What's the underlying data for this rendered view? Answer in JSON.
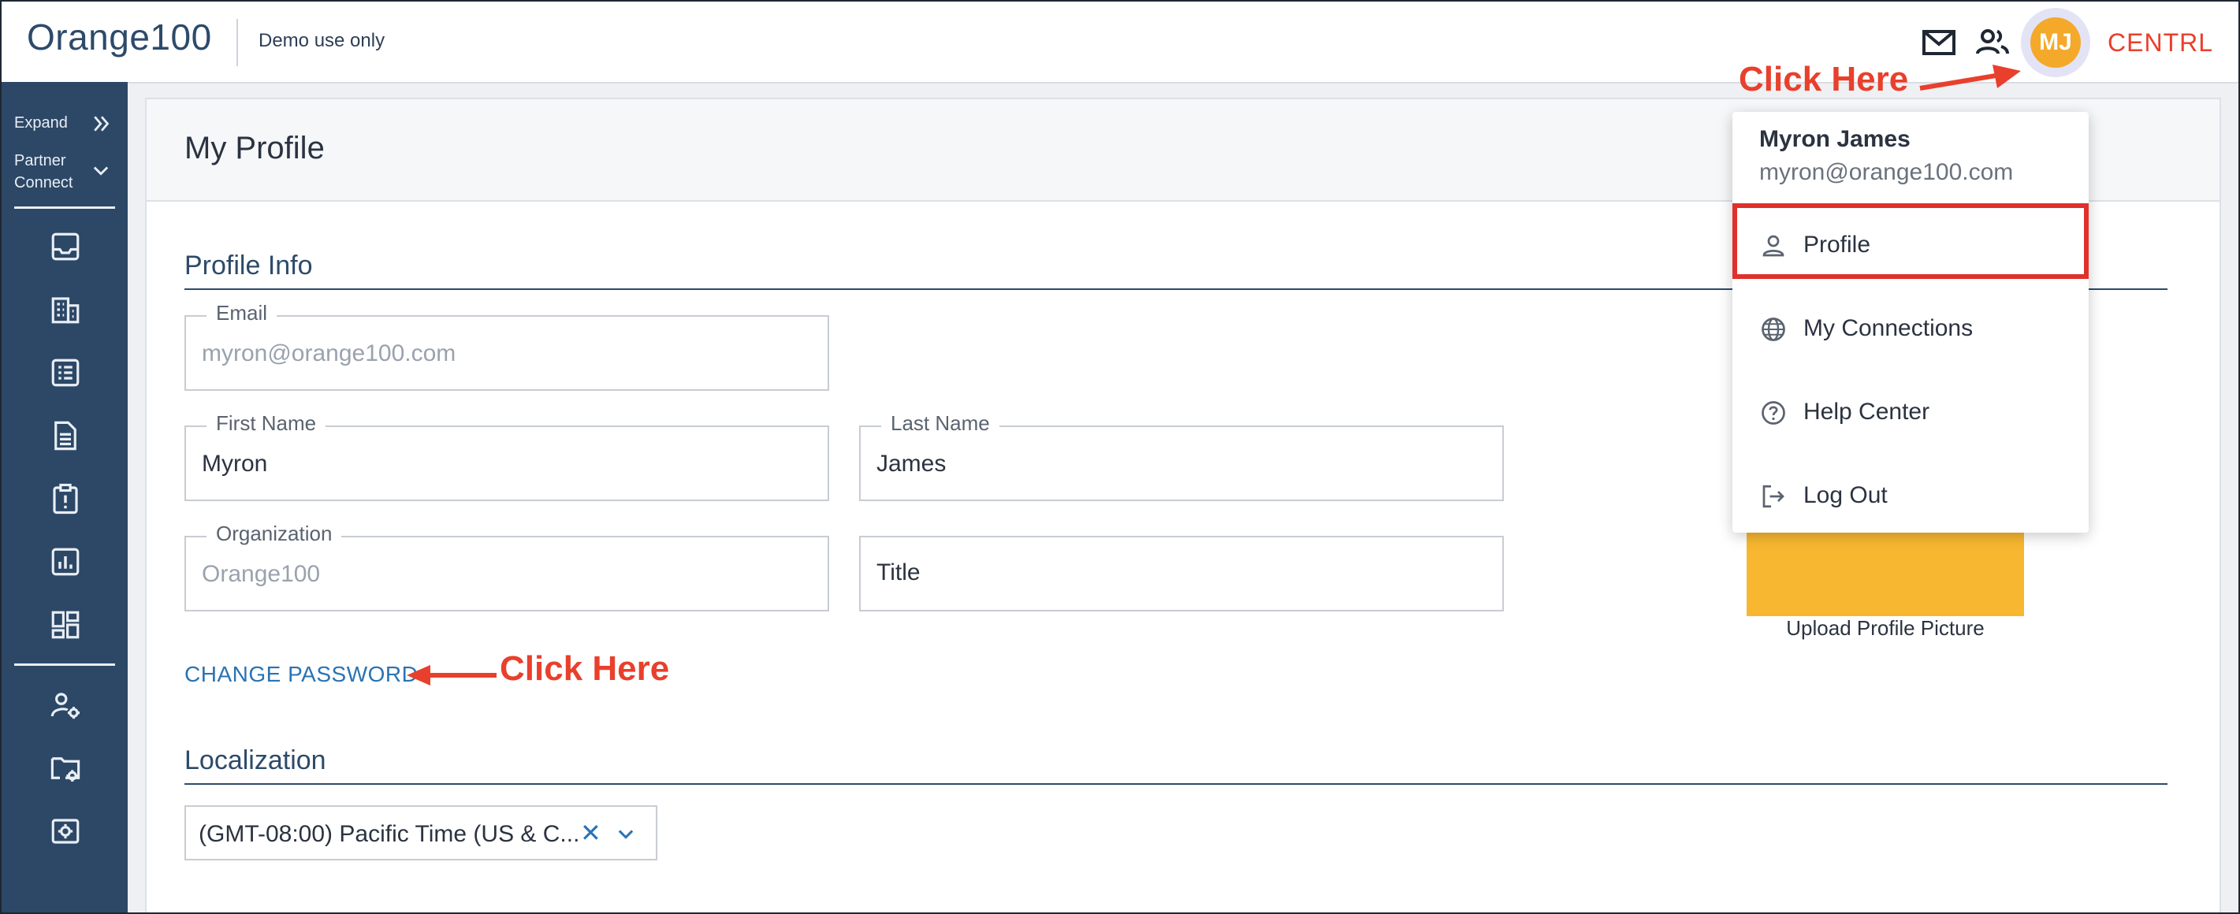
{
  "header": {
    "brand": "Orange100",
    "demo_label": "Demo use only",
    "avatar_initials": "MJ",
    "product": "CENTRL"
  },
  "sidebar": {
    "expand_label": "Expand",
    "partner_line1": "Partner",
    "partner_line2": "Connect",
    "icons": [
      "inbox-icon",
      "building-icon",
      "checklist-icon",
      "document-icon",
      "alert-clipboard-icon",
      "report-chart-icon",
      "dashboard-icon",
      "user-settings-icon",
      "folder-settings-icon",
      "admin-settings-icon"
    ]
  },
  "page": {
    "title": "My Profile"
  },
  "profile_info": {
    "section_title": "Profile Info",
    "email_label": "Email",
    "email_value": "myron@orange100.com",
    "first_name_label": "First Name",
    "first_name_value": "Myron",
    "last_name_label": "Last Name",
    "last_name_value": "James",
    "organization_label": "Organization",
    "organization_value": "Orange100",
    "title_placeholder": "Title",
    "change_password": "CHANGE PASSWORD",
    "upload_label": "Upload Profile Picture"
  },
  "localization": {
    "section_title": "Localization",
    "timezone_value": "(GMT-08:00) Pacific Time (US & C...",
    "clear_symbol": "✕"
  },
  "annotations": {
    "click_here_top": "Click Here",
    "click_here_password": "Click Here"
  },
  "user_menu": {
    "name": "Myron James",
    "email": "myron@orange100.com",
    "items": [
      {
        "label": "Profile",
        "icon": "person-icon"
      },
      {
        "label": "My Connections",
        "icon": "globe-icon"
      },
      {
        "label": "Help Center",
        "icon": "help-icon"
      },
      {
        "label": "Log Out",
        "icon": "logout-icon"
      }
    ]
  },
  "colors": {
    "brand_text": "#2d4a6a",
    "sidebar_bg": "#2c4866",
    "accent_orange": "#f4a92a",
    "annotation_red": "#e8402c",
    "link_blue": "#2a73b3"
  }
}
